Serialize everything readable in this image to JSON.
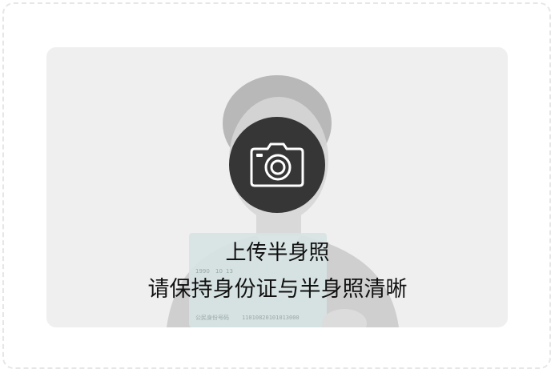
{
  "upload": {
    "title": "上传半身照",
    "hint": "请保持身份证与半身照清晰",
    "icon": "camera-icon"
  },
  "id_card_sample": {
    "birth_year": "1990",
    "birth_month": "10",
    "birth_day": "13",
    "id_label": "公民身份号码",
    "id_number": "11010820101013000"
  },
  "colors": {
    "frame_border": "#e6e6e6",
    "area_background": "#efefef",
    "icon_circle": "#282828",
    "text": "#111111"
  }
}
